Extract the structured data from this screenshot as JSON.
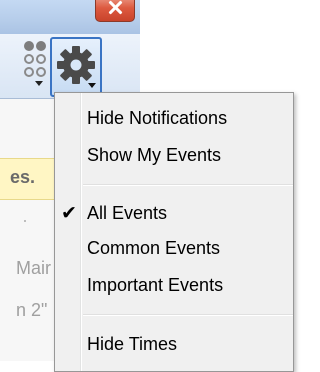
{
  "window": {
    "close_icon": "close-icon"
  },
  "toolbar": {
    "view_button_icon": "dot-grid-icon",
    "settings_button_icon": "gear-icon",
    "dropdown_icon": "chevron-down-icon"
  },
  "background": {
    "banner_text": "es.",
    "lines": [
      "Mair",
      "n 2\""
    ]
  },
  "menu": {
    "items": [
      {
        "label": "Hide Notifications",
        "checked": false
      },
      {
        "label": "Show My Events",
        "checked": false
      },
      {
        "label": "All Events",
        "checked": true
      },
      {
        "label": "Common Events",
        "checked": false
      },
      {
        "label": "Important Events",
        "checked": false
      },
      {
        "label": "Hide Times",
        "checked": false
      }
    ],
    "check_glyph": "✔"
  },
  "colors": {
    "accent": "#3a74c4",
    "close": "#dd5a40",
    "banner": "#fff6c4",
    "menu_bg": "#f0f0f0"
  }
}
